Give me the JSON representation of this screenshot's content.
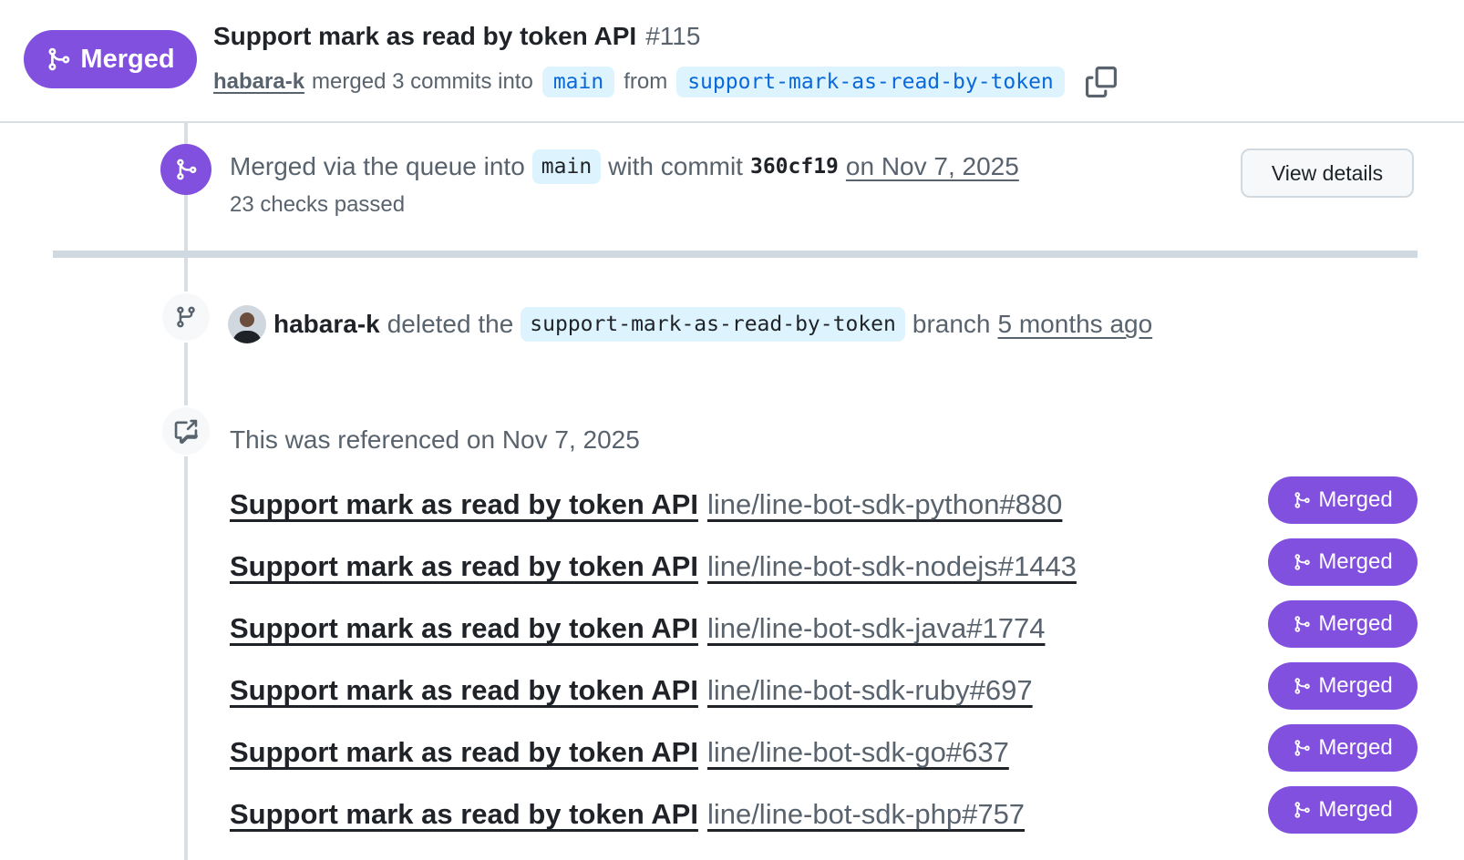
{
  "header": {
    "state_label": "Merged",
    "title": "Support mark as read by token API",
    "number": "#115",
    "author": "habara-k",
    "merged_text": "merged 3 commits into",
    "base_branch": "main",
    "from_text": "from",
    "head_branch": "support-mark-as-read-by-token"
  },
  "merge_event": {
    "prefix": "Merged via the queue into",
    "branch": "main",
    "with_commit": "with commit",
    "sha": "360cf19",
    "date": "on Nov 7, 2025",
    "checks": "23 checks passed",
    "view_details": "View details"
  },
  "delete_event": {
    "user": "habara-k",
    "text": "deleted the",
    "branch": "support-mark-as-read-by-token",
    "suffix": "branch",
    "time": "5 months ago"
  },
  "references": {
    "header": "This was referenced on Nov 7, 2025",
    "items": [
      {
        "title": "Support mark as read by token API",
        "repo": "line/line-bot-sdk-python#880",
        "state": "Merged"
      },
      {
        "title": "Support mark as read by token API",
        "repo": "line/line-bot-sdk-nodejs#1443",
        "state": "Merged"
      },
      {
        "title": "Support mark as read by token API",
        "repo": "line/line-bot-sdk-java#1774",
        "state": "Merged"
      },
      {
        "title": "Support mark as read by token API",
        "repo": "line/line-bot-sdk-ruby#697",
        "state": "Merged"
      },
      {
        "title": "Support mark as read by token API",
        "repo": "line/line-bot-sdk-go#637",
        "state": "Merged"
      },
      {
        "title": "Support mark as read by token API",
        "repo": "line/line-bot-sdk-php#757",
        "state": "Merged"
      }
    ]
  },
  "colors": {
    "merged": "#8250df",
    "branch_chip_bg": "#ddf4ff",
    "branch_chip_text": "#0969da",
    "muted": "#59636e"
  },
  "icons": {
    "merge": "git-merge-icon",
    "branch": "git-branch-icon",
    "reference": "cross-reference-icon",
    "copy": "copy-icon"
  }
}
